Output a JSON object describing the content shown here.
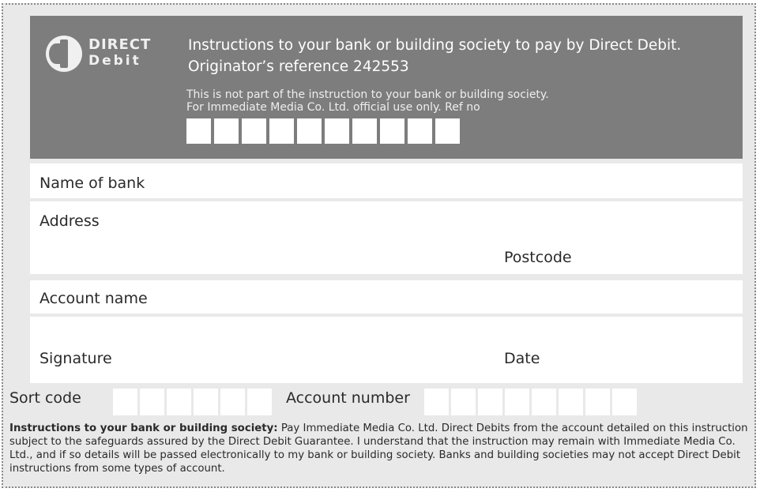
{
  "header": {
    "logo": {
      "line1": "DIRECT",
      "line2": "Debit"
    },
    "title_line1": "Instructions to your bank or building society to pay by Direct Debit.",
    "title_line2": "Originator’s reference 242553",
    "note_line1": "This is not part of the instruction to your bank or building society.",
    "note_line2": "For Immediate Media Co. Ltd. official use only. Ref no",
    "ref_box_count": 10
  },
  "fields": {
    "name_of_bank": "Name of bank",
    "address": "Address",
    "postcode": "Postcode",
    "account_name": "Account name",
    "signature": "Signature",
    "date": "Date",
    "sort_code": "Sort code",
    "account_number": "Account number"
  },
  "sort_code_box_count": 6,
  "account_number_box_count": 8,
  "footer": {
    "heading": "Instructions to your bank or building society:",
    "text": " Pay Immediate Media Co. Ltd. Direct Debits from the account detailed on this instruction subject to the safeguards assured by the Direct Debit Guarantee. I understand that the instruction may remain with Immediate Media Co. Ltd., and if so details will be passed electronically to my bank or building society. Banks and building societies may not accept Direct Debit instructions from some types of account."
  },
  "colors": {
    "header_bg": "#7d7d7d",
    "form_bg": "#e9e9e9",
    "field_bg": "#ffffff"
  }
}
